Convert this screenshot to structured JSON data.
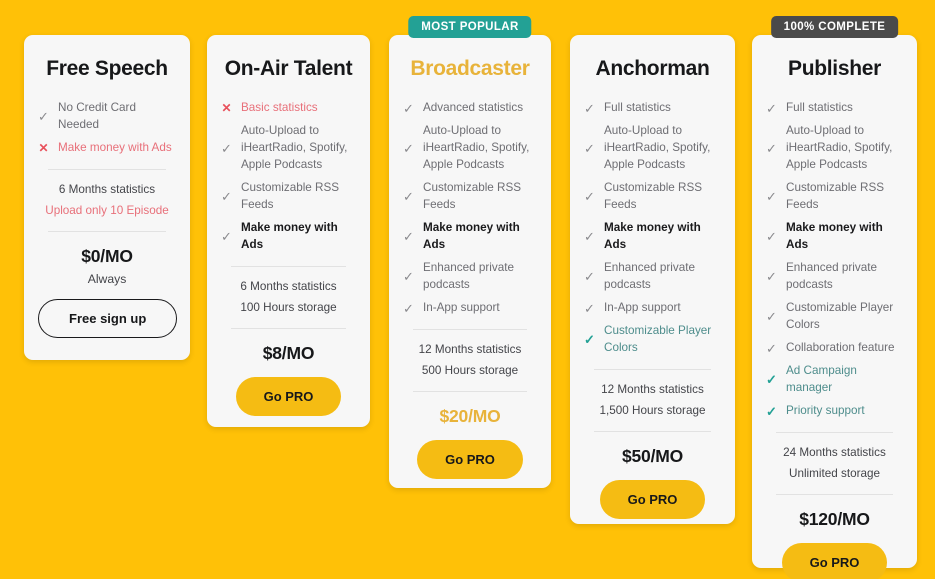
{
  "theme": {
    "page_background": "#FFC107",
    "card_background": "#F7F7F7",
    "button_color": "#F5BC13",
    "accent_gold": "#E8B33A",
    "accent_teal": "#23A195",
    "accent_red": "#E8505B",
    "badge_dark": "#4A4A4A"
  },
  "plans": [
    {
      "id": "free-speech",
      "badge": null,
      "title": "Free Speech",
      "title_color": "dark",
      "features": [
        {
          "mark": "check-icon",
          "glyph": "✓",
          "text": "No Credit Card Needed",
          "style": "normal"
        },
        {
          "mark": "cross-icon",
          "glyph": "✕",
          "text": "Make money with Ads",
          "style": "neg"
        }
      ],
      "meta": [
        {
          "text": "6 Months statistics",
          "style": "normal"
        },
        {
          "text": "Upload only 10 Episode",
          "style": "neg"
        }
      ],
      "price": "$0/MO",
      "price_style": "dark",
      "subtext": "Always",
      "button": {
        "label": "Free sign up",
        "style": "ghost"
      }
    },
    {
      "id": "on-air-talent",
      "badge": null,
      "title": "On-Air Talent",
      "title_color": "dark",
      "features": [
        {
          "mark": "cross-icon",
          "glyph": "✕",
          "text": "Basic statistics",
          "style": "neg"
        },
        {
          "mark": "check-icon",
          "glyph": "✓",
          "text": "Auto-Upload to iHeartRadio, Spotify, Apple Podcasts",
          "style": "normal"
        },
        {
          "mark": "check-icon",
          "glyph": "✓",
          "text": "Customizable RSS Feeds",
          "style": "normal"
        },
        {
          "mark": "check-icon",
          "glyph": "✓",
          "text": "Make money with Ads",
          "style": "bold"
        }
      ],
      "meta": [
        {
          "text": "6 Months statistics",
          "style": "normal"
        },
        {
          "text": "100 Hours storage",
          "style": "normal"
        }
      ],
      "price": "$8/MO",
      "price_style": "dark",
      "subtext": null,
      "button": {
        "label": "Go PRO",
        "style": "solid"
      }
    },
    {
      "id": "broadcaster",
      "badge": {
        "label": "MOST POPULAR",
        "color": "#23A195"
      },
      "title": "Broadcaster",
      "title_color": "gold",
      "features": [
        {
          "mark": "check-icon",
          "glyph": "✓",
          "text": "Advanced statistics",
          "style": "normal"
        },
        {
          "mark": "check-icon",
          "glyph": "✓",
          "text": "Auto-Upload to iHeartRadio, Spotify, Apple Podcasts",
          "style": "normal"
        },
        {
          "mark": "check-icon",
          "glyph": "✓",
          "text": "Customizable RSS Feeds",
          "style": "normal"
        },
        {
          "mark": "check-icon",
          "glyph": "✓",
          "text": "Make money with Ads",
          "style": "bold"
        },
        {
          "mark": "check-icon",
          "glyph": "✓",
          "text": "Enhanced private podcasts",
          "style": "normal"
        },
        {
          "mark": "check-icon",
          "glyph": "✓",
          "text": "In-App support",
          "style": "normal"
        }
      ],
      "meta": [
        {
          "text": "12 Months statistics",
          "style": "normal"
        },
        {
          "text": "500 Hours storage",
          "style": "normal"
        }
      ],
      "price": "$20/MO",
      "price_style": "gold",
      "subtext": null,
      "button": {
        "label": "Go PRO",
        "style": "solid"
      }
    },
    {
      "id": "anchorman",
      "badge": null,
      "title": "Anchorman",
      "title_color": "dark",
      "features": [
        {
          "mark": "check-icon",
          "glyph": "✓",
          "text": "Full statistics",
          "style": "normal"
        },
        {
          "mark": "check-icon",
          "glyph": "✓",
          "text": "Auto-Upload to iHeartRadio, Spotify, Apple Podcasts",
          "style": "normal"
        },
        {
          "mark": "check-icon",
          "glyph": "✓",
          "text": "Customizable RSS Feeds",
          "style": "normal"
        },
        {
          "mark": "check-icon",
          "glyph": "✓",
          "text": "Make money with Ads",
          "style": "bold"
        },
        {
          "mark": "check-icon",
          "glyph": "✓",
          "text": "Enhanced private podcasts",
          "style": "normal"
        },
        {
          "mark": "check-icon",
          "glyph": "✓",
          "text": "In-App support",
          "style": "normal"
        },
        {
          "mark": "check-icon",
          "glyph": "✓",
          "text": "Customizable Player Colors",
          "style": "teal"
        }
      ],
      "meta": [
        {
          "text": "12 Months statistics",
          "style": "normal"
        },
        {
          "text": "1,500 Hours storage",
          "style": "normal"
        }
      ],
      "price": "$50/MO",
      "price_style": "dark",
      "subtext": null,
      "button": {
        "label": "Go PRO",
        "style": "solid"
      }
    },
    {
      "id": "publisher",
      "badge": {
        "label": "100% COMPLETE",
        "color": "#4A4A4A"
      },
      "title": "Publisher",
      "title_color": "dark",
      "features": [
        {
          "mark": "check-icon",
          "glyph": "✓",
          "text": "Full statistics",
          "style": "normal"
        },
        {
          "mark": "check-icon",
          "glyph": "✓",
          "text": "Auto-Upload to iHeartRadio, Spotify, Apple Podcasts",
          "style": "normal"
        },
        {
          "mark": "check-icon",
          "glyph": "✓",
          "text": "Customizable RSS Feeds",
          "style": "normal"
        },
        {
          "mark": "check-icon",
          "glyph": "✓",
          "text": "Make money with Ads",
          "style": "bold"
        },
        {
          "mark": "check-icon",
          "glyph": "✓",
          "text": "Enhanced private podcasts",
          "style": "normal"
        },
        {
          "mark": "check-icon",
          "glyph": "✓",
          "text": "Customizable Player Colors",
          "style": "normal"
        },
        {
          "mark": "check-icon",
          "glyph": "✓",
          "text": "Collaboration feature",
          "style": "normal"
        },
        {
          "mark": "check-icon",
          "glyph": "✓",
          "text": "Ad Campaign manager",
          "style": "teal"
        },
        {
          "mark": "check-icon",
          "glyph": "✓",
          "text": "Priority support",
          "style": "teal"
        }
      ],
      "meta": [
        {
          "text": "24 Months statistics",
          "style": "normal"
        },
        {
          "text": "Unlimited storage",
          "style": "normal"
        }
      ],
      "price": "$120/MO",
      "price_style": "dark",
      "subtext": null,
      "button": {
        "label": "Go PRO",
        "style": "solid"
      }
    }
  ]
}
